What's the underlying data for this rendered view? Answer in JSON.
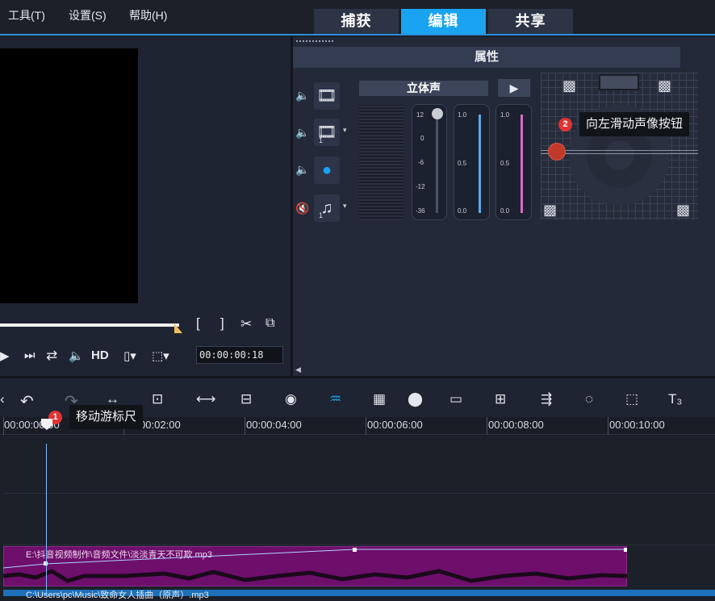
{
  "menu": {
    "tools": "工具(T)",
    "settings": "设置(S)",
    "help": "帮助(H)"
  },
  "tabs": {
    "capture": "捕获",
    "edit": "编辑",
    "share": "共享"
  },
  "preview": {
    "hd_label": "HD",
    "timecode": "00:00:00:18",
    "mark_in": "[",
    "mark_out": "]"
  },
  "properties": {
    "title": "属性",
    "stereo_label": "立体声",
    "fader1_ticks": [
      "12",
      "0",
      "-6",
      "-12",
      "-36"
    ],
    "fader2_ticks": [
      "1.0",
      "0.5",
      "0.0"
    ],
    "fader3_ticks": [
      "1.0",
      "0.5",
      "0.0"
    ],
    "track_numbers": [
      "1",
      "1"
    ]
  },
  "tooltips": {
    "surround": {
      "number": "2",
      "text": "向左滑动声像按钮"
    },
    "ruler": {
      "number": "1",
      "text": "移动游标尺"
    }
  },
  "ruler": {
    "ticks": [
      "00:00:00:00",
      "00:00:02:00",
      "00:00:04:00",
      "00:00:06:00",
      "00:00:08:00",
      "00:00:10:00"
    ]
  },
  "timeline": {
    "clip1_path": "E:\\抖音视频制作\\音频文件\\淡淡青天不可欺.mp3",
    "clip2_path": "C:\\Users\\pc\\Music\\致命女人插曲（原声）.mp3"
  },
  "colors": {
    "accent": "#1aa3f0",
    "clip_audio": "#6d0f6b",
    "clip_music": "#1d6fb8",
    "badge": "#e23232"
  }
}
